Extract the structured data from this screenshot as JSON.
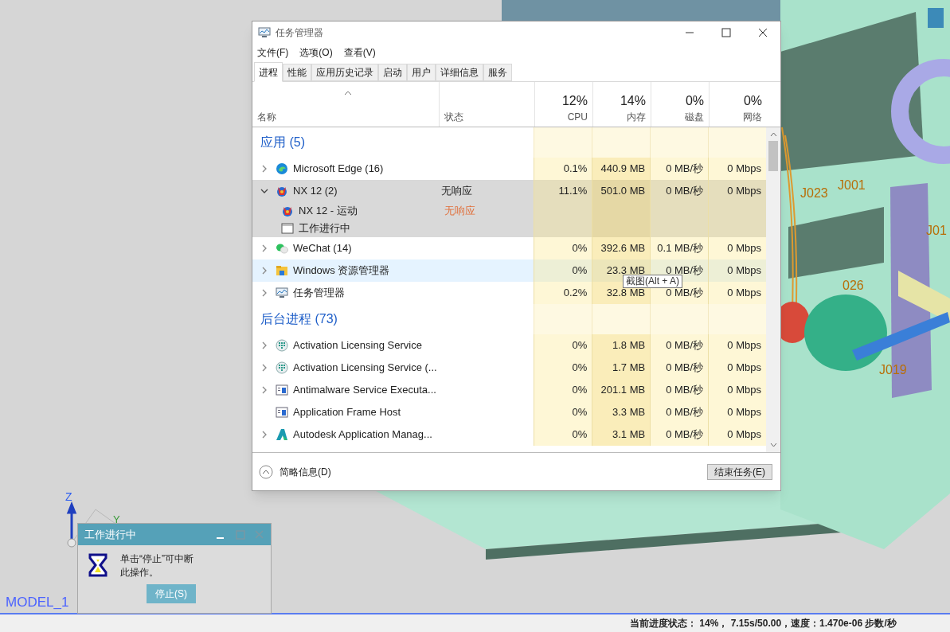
{
  "viewport": {
    "joint_labels": [
      "J023",
      "J001",
      "J01",
      "026",
      "J019"
    ],
    "triad_labels": [
      "Z",
      "Y"
    ],
    "model_name": "MODEL_1"
  },
  "task_manager": {
    "title": "任务管理器",
    "menu": [
      "文件(F)",
      "选项(O)",
      "查看(V)"
    ],
    "tabs": [
      {
        "label": "进程",
        "selected": true
      },
      {
        "label": "性能",
        "selected": false
      },
      {
        "label": "应用历史记录",
        "selected": false
      },
      {
        "label": "启动",
        "selected": false
      },
      {
        "label": "用户",
        "selected": false
      },
      {
        "label": "详细信息",
        "selected": false
      },
      {
        "label": "服务",
        "selected": false
      }
    ],
    "columns": [
      {
        "label": "名称"
      },
      {
        "label": "状态"
      },
      {
        "usage": "12%",
        "label": "CPU"
      },
      {
        "usage": "14%",
        "label": "内存"
      },
      {
        "usage": "0%",
        "label": "磁盘"
      },
      {
        "usage": "0%",
        "label": "网络"
      }
    ],
    "groups": [
      {
        "title": "应用 (5)",
        "rows": [
          {
            "kind": "edge",
            "name": "Microsoft Edge (16)",
            "cpu": "0.1%",
            "memory": "440.9 MB",
            "disk": "0 MB/秒",
            "network": "0 Mbps",
            "expandable": true,
            "expanded": false,
            "selected": false,
            "hovered": false
          },
          {
            "kind": "nx",
            "name": "NX 12 (2)",
            "status": "无响应",
            "cpu": "11.1%",
            "memory": "501.0 MB",
            "disk": "0 MB/秒",
            "network": "0 Mbps",
            "expandable": true,
            "expanded": true,
            "selected": true,
            "hovered": false,
            "children": [
              {
                "kind": "nx",
                "name": "NX 12 - 运动",
                "status": "无响应"
              },
              {
                "kind": "window",
                "name": "工作进行中"
              }
            ]
          },
          {
            "kind": "wechat",
            "name": "WeChat (14)",
            "cpu": "0%",
            "memory": "392.6 MB",
            "disk": "0.1 MB/秒",
            "network": "0 Mbps",
            "expandable": true,
            "expanded": false,
            "selected": false,
            "hovered": false
          },
          {
            "kind": "folder",
            "name": "Windows 资源管理器",
            "cpu": "0%",
            "memory": "23.3 MB",
            "disk": "0 MB/秒",
            "network": "0 Mbps",
            "expandable": true,
            "expanded": false,
            "selected": false,
            "hovered": true
          },
          {
            "kind": "monitor",
            "name": "任务管理器",
            "cpu": "0.2%",
            "memory": "32.8 MB",
            "disk": "0 MB/秒",
            "network": "0 Mbps",
            "expandable": true,
            "expanded": false,
            "selected": false,
            "hovered": false
          }
        ]
      },
      {
        "title": "后台进程 (73)",
        "rows": [
          {
            "kind": "service",
            "name": "Activation Licensing Service",
            "cpu": "0%",
            "memory": "1.8 MB",
            "disk": "0 MB/秒",
            "network": "0 Mbps",
            "expandable": true,
            "expanded": false,
            "selected": false,
            "hovered": false
          },
          {
            "kind": "service",
            "name": "Activation Licensing Service (...",
            "cpu": "0%",
            "memory": "1.7 MB",
            "disk": "0 MB/秒",
            "network": "0 Mbps",
            "expandable": true,
            "expanded": false,
            "selected": false,
            "hovered": false
          },
          {
            "kind": "frame",
            "name": "Antimalware Service Executa...",
            "cpu": "0%",
            "memory": "201.1 MB",
            "disk": "0 MB/秒",
            "network": "0 Mbps",
            "expandable": true,
            "expanded": false,
            "selected": false,
            "hovered": false
          },
          {
            "kind": "frame",
            "name": "Application Frame Host",
            "cpu": "0%",
            "memory": "3.3 MB",
            "disk": "0 MB/秒",
            "network": "0 Mbps",
            "expandable": false,
            "selected": false,
            "hovered": false
          },
          {
            "kind": "triangle",
            "name": "Autodesk Application Manag...",
            "cpu": "0%",
            "memory": "3.1 MB",
            "disk": "0 MB/秒",
            "network": "0 Mbps",
            "expandable": true,
            "expanded": false,
            "selected": false,
            "hovered": false
          }
        ]
      }
    ],
    "footer": {
      "details": "简略信息(D)",
      "end_task": "结束任务(E)"
    },
    "tooltip": "截图(Alt + A)"
  },
  "dialog": {
    "title": "工作进行中",
    "message": "单击“停止”可中断此操作。",
    "button": "停止(S)"
  },
  "status_bar": "当前进度状态： 14%， 7.15s/50.00，速度：1.470e-06 步数/秒"
}
